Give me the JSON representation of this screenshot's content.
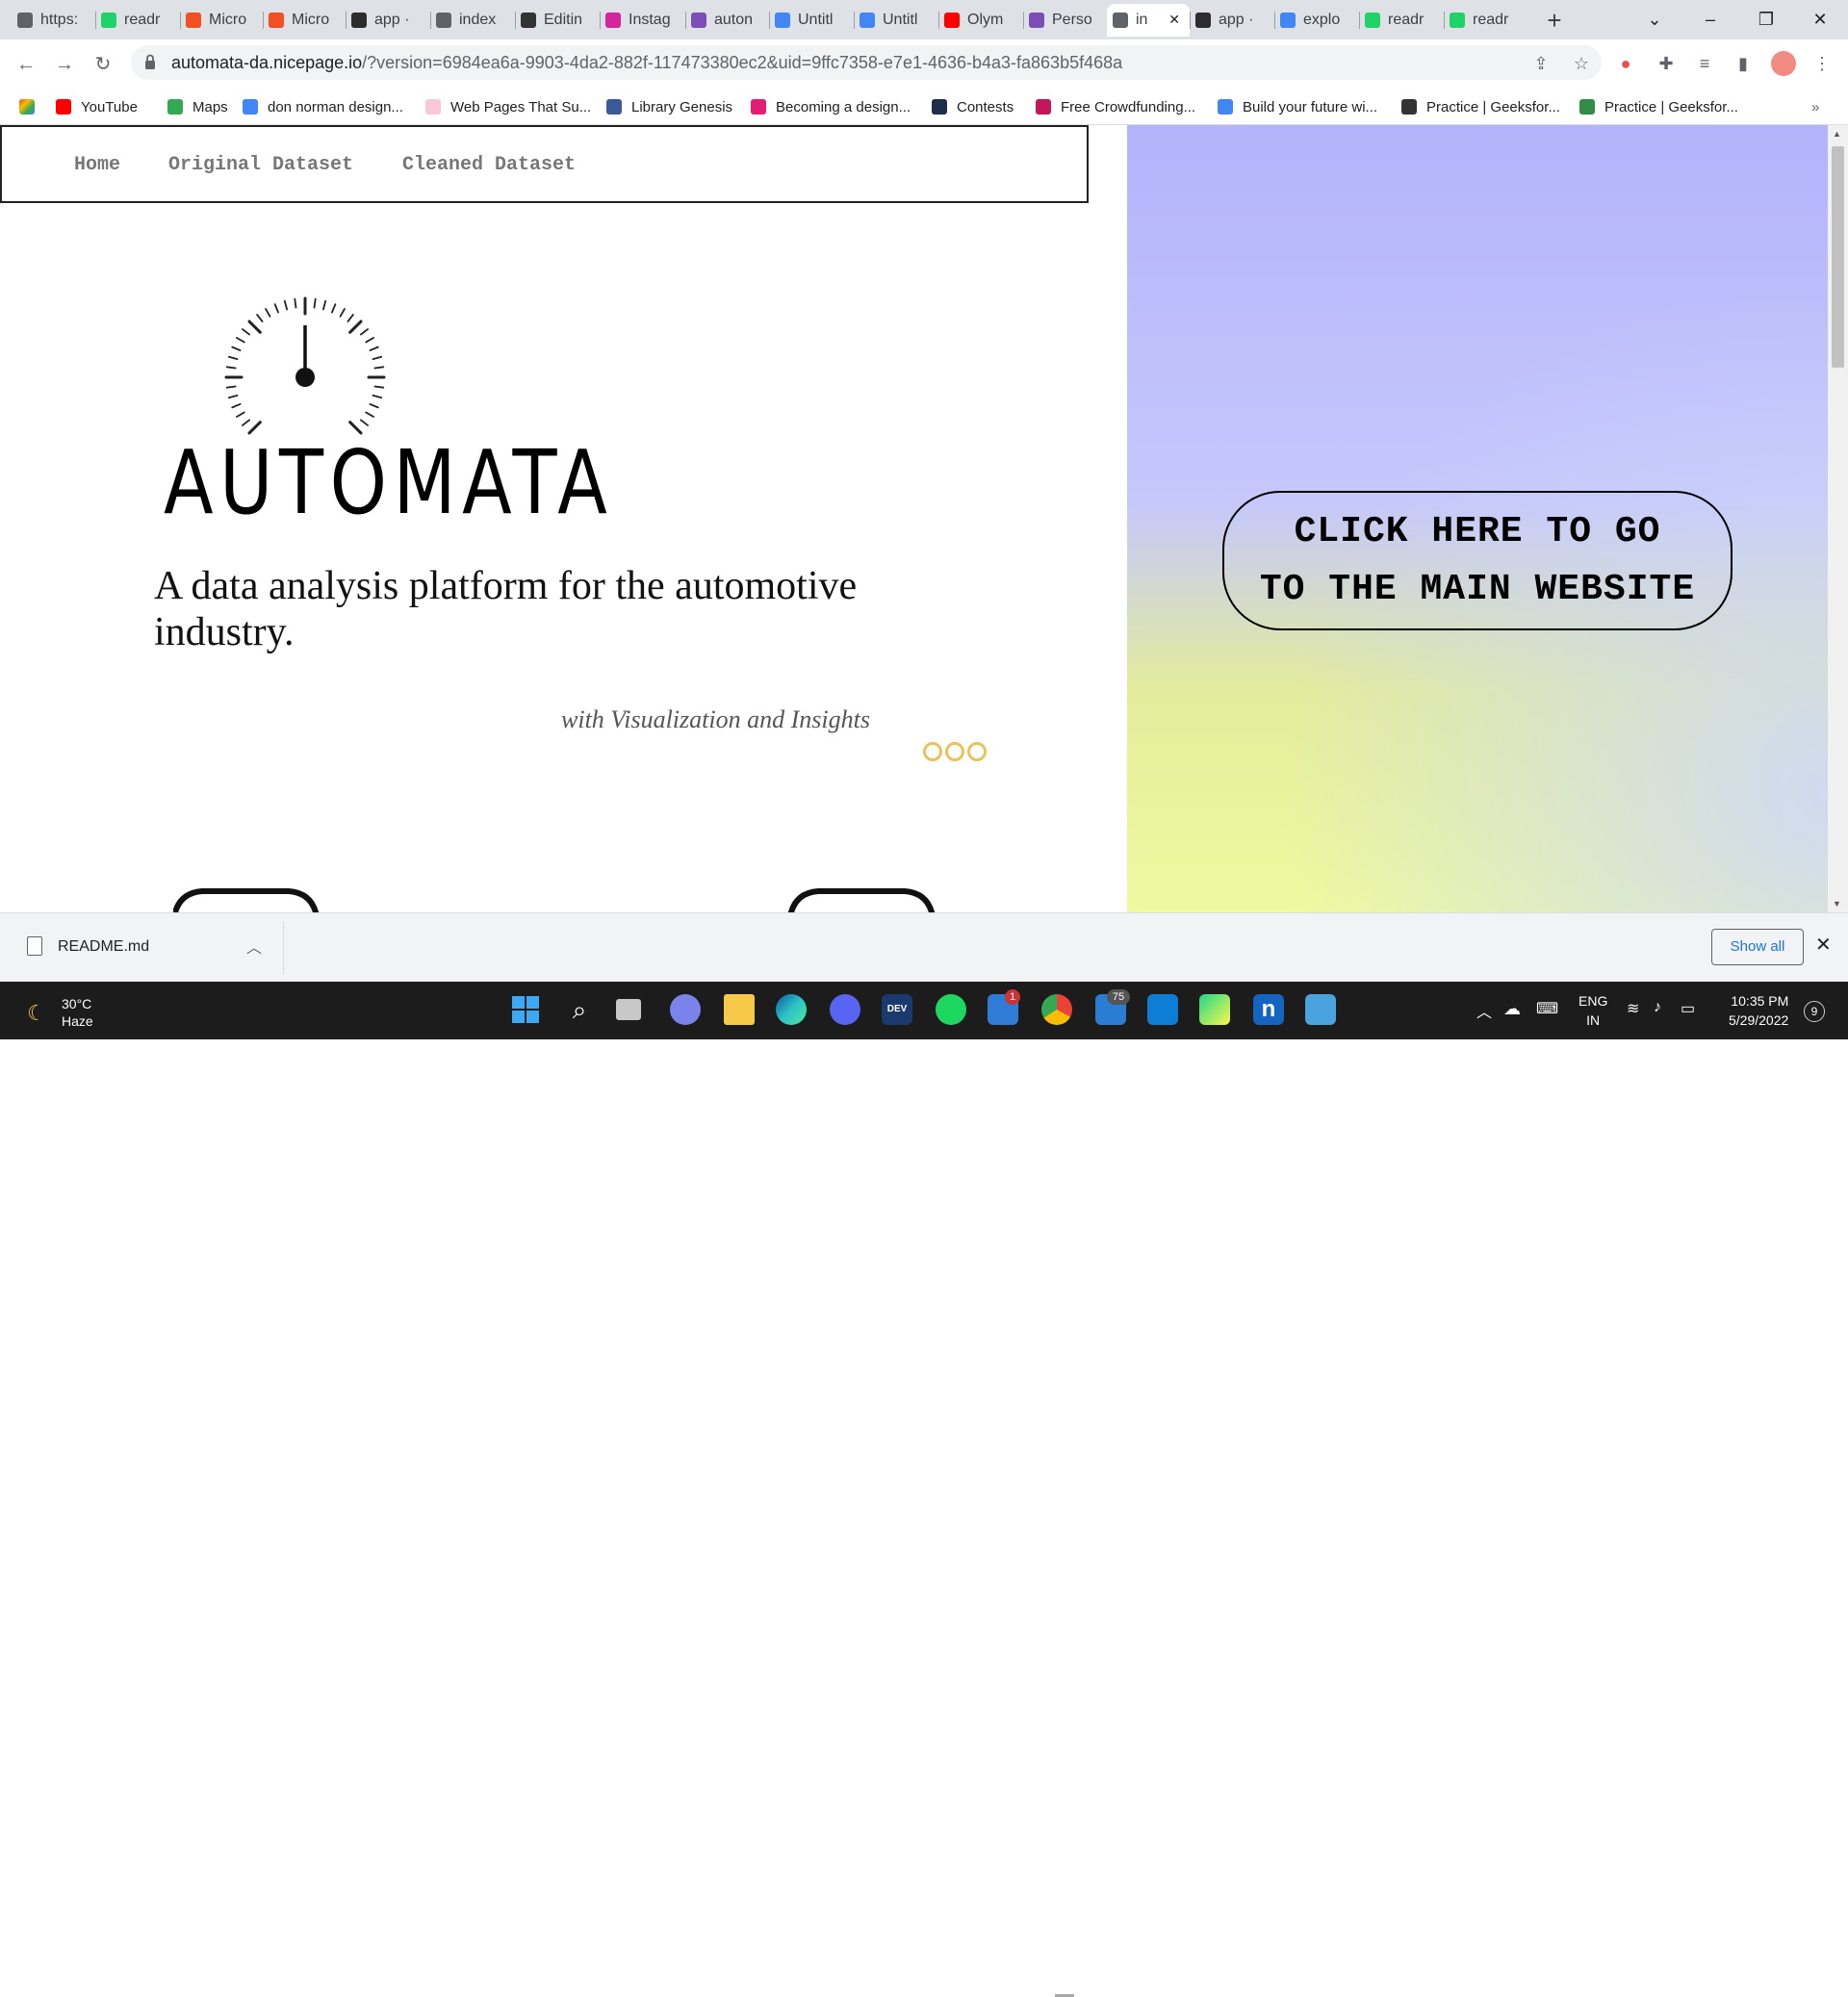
{
  "browser": {
    "tabs": [
      {
        "label": "https:",
        "color": "#5f6368"
      },
      {
        "label": "readr",
        "color": "#1fd36a"
      },
      {
        "label": "Micro",
        "color": "#f25022"
      },
      {
        "label": "Micro",
        "color": "#f25022"
      },
      {
        "label": "app ·",
        "color": "#2d2d2d"
      },
      {
        "label": "index",
        "color": "#5f6368"
      },
      {
        "label": "Editin",
        "color": "#333333"
      },
      {
        "label": "Instag",
        "color": "#d6249f"
      },
      {
        "label": "auton",
        "color": "#7b4fb5"
      },
      {
        "label": "Untitl",
        "color": "#4285f4"
      },
      {
        "label": "Untitl",
        "color": "#4285f4"
      },
      {
        "label": "Olym",
        "color": "#ff0000"
      },
      {
        "label": "Perso",
        "color": "#7b4fb5"
      },
      {
        "label": "in",
        "color": "#5f6368",
        "active": true
      },
      {
        "label": "app ·",
        "color": "#2d2d2d"
      },
      {
        "label": "explo",
        "color": "#4285f4"
      },
      {
        "label": "readr",
        "color": "#1fd36a"
      },
      {
        "label": "readr",
        "color": "#1fd36a"
      }
    ],
    "url_main": "automata-da.nicepage.io",
    "url_rest": "/?version=6984ea6a-9903-4da2-882f-117473380ec2&uid=9ffc7358-e7e1-4636-b4a3-fa863b5f468a",
    "bookmarks": [
      {
        "label": "YouTube",
        "color": "#ff0000"
      },
      {
        "label": "Maps",
        "color": "#34a853"
      },
      {
        "label": "don norman design...",
        "color": "#4285f4"
      },
      {
        "label": "Web Pages That Su...",
        "color": "#f8c8d8"
      },
      {
        "label": "Library Genesis",
        "color": "#3b5998"
      },
      {
        "label": "Becoming a design...",
        "color": "#e11d74"
      },
      {
        "label": "Contests",
        "color": "#1f2d4d"
      },
      {
        "label": "Free Crowdfunding...",
        "color": "#c2185b"
      },
      {
        "label": "Build your future wi...",
        "color": "#4285f4"
      },
      {
        "label": "Practice | Geeksfor...",
        "color": "#333333"
      },
      {
        "label": "Practice | Geeksfor...",
        "color": "#2f8d46"
      }
    ],
    "bookmarks_more": "»"
  },
  "site": {
    "nav": {
      "home": "Home",
      "original": "Original Dataset",
      "cleaned": "Cleaned Dataset"
    },
    "brand": "AUTOMATA",
    "tagline": "A data analysis platform for the automotive industry.",
    "subline": "with Visualization and Insights",
    "cta_line1": "CLICK HERE TO GO",
    "cta_line2": "TO THE MAIN WEBSITE",
    "accent": "#e8c35a"
  },
  "download": {
    "filename": "README.md",
    "show_all": "Show all"
  },
  "taskbar": {
    "temp": "30°C",
    "weather": "Haze",
    "lang1": "ENG",
    "lang2": "IN",
    "time": "10:35 PM",
    "date": "5/29/2022",
    "notif_count": "9",
    "badge_mail": "1",
    "badge_tasks": "75"
  }
}
